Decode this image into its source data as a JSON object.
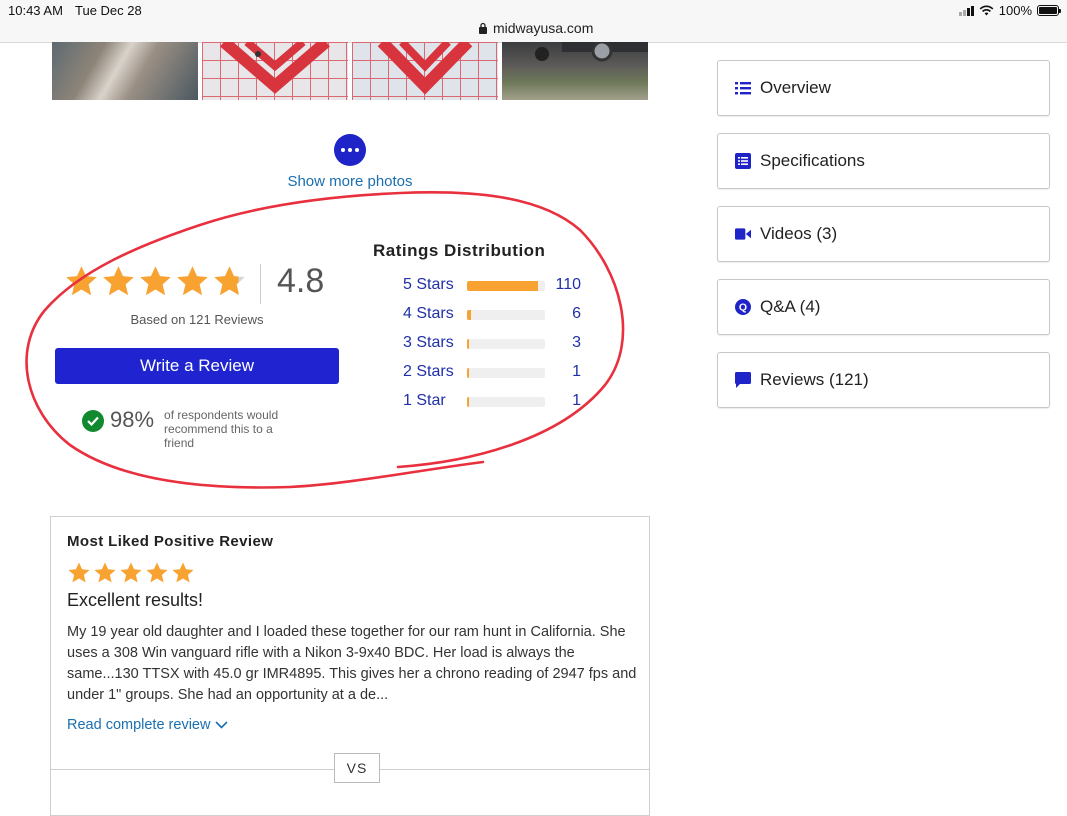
{
  "status_bar": {
    "time": "10:43 AM",
    "date": "Tue Dec 28",
    "url": "midwayusa.com",
    "battery": "100%"
  },
  "gallery": {
    "show_more_label": "Show more photos"
  },
  "rating_summary": {
    "average": "4.8",
    "stars_value": 4.8,
    "based_on": "Based on 121 Reviews",
    "write_review_label": "Write a Review",
    "recommend_percent": "98%",
    "recommend_text": "of respondents would recommend this to a friend"
  },
  "distribution": {
    "title": "Ratings Distribution",
    "rows": [
      {
        "label": "5 Stars",
        "count": "110",
        "fraction": 0.909
      },
      {
        "label": "4 Stars",
        "count": "6",
        "fraction": 0.05
      },
      {
        "label": "3 Stars",
        "count": "3",
        "fraction": 0.025
      },
      {
        "label": "2 Stars",
        "count": "1",
        "fraction": 0.01
      },
      {
        "label": "1 Star",
        "count": "1",
        "fraction": 0.01
      }
    ]
  },
  "review_card": {
    "title": "Most Liked Positive Review",
    "stars_value": 5,
    "headline": "Excellent results!",
    "body": "My 19 year old daughter and I loaded these together for our ram hunt in California. She uses a 308 Win vanguard rifle with a Nikon 3-9x40 BDC. Her load is always the same...130 TTSX with 45.0 gr IMR4895. This gives her a chrono reading of 2947 fps and under 1\" groups. She had an opportunity at a de...",
    "read_more": "Read complete review",
    "vs_label": "VS"
  },
  "side_nav": [
    {
      "label": "Overview",
      "icon": "list-icon"
    },
    {
      "label": "Specifications",
      "icon": "spec-sheet-icon"
    },
    {
      "label": "Videos (3)",
      "icon": "video-camera-icon"
    },
    {
      "label": "Q&A (4)",
      "icon": "q-circle-icon"
    },
    {
      "label": "Reviews (121)",
      "icon": "speech-bubble-icon"
    }
  ],
  "colors": {
    "accent_blue": "#1f24d0",
    "star_orange": "#f7a231",
    "annotation_red": "#e8303e",
    "check_green": "#10892f"
  }
}
